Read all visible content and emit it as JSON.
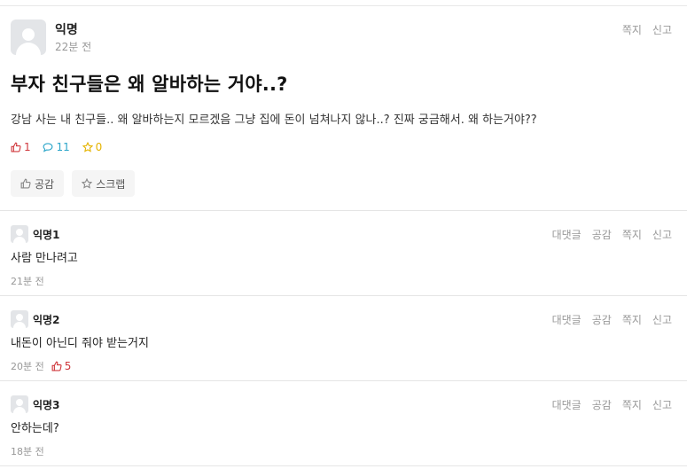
{
  "post": {
    "author": "익명",
    "time": "22분 전",
    "actions": {
      "message": "쪽지",
      "report": "신고"
    },
    "title": "부자 친구들은 왜 알바하는 거야..?",
    "content": "강남 사는 내 친구들.. 왜 알바하는지 모르겠음 그냥 집에 돈이 넘쳐나지 않나..? 진짜 궁금해서. 왜 하는거야??",
    "stats": {
      "likes": "1",
      "comments": "11",
      "scraps": "0"
    },
    "buttons": {
      "like": "공감",
      "scrap": "스크랩"
    }
  },
  "comment_actions": {
    "reply": "대댓글",
    "like": "공감",
    "message": "쪽지",
    "report": "신고"
  },
  "comments": [
    {
      "author": "익명1",
      "text": "사람 만나려고",
      "time": "21분 전",
      "likes": ""
    },
    {
      "author": "익명2",
      "text": "내돈이 아닌디 줘야 받는거지",
      "time": "20분 전",
      "likes": "5"
    },
    {
      "author": "익명3",
      "text": "안하는데?",
      "time": "18분 전",
      "likes": ""
    }
  ],
  "colors": {
    "like": "#d0393e",
    "comment": "#2ba5c9",
    "scrap": "#e5b300"
  },
  "icons": {
    "avatar": "person-icon",
    "like": "thumbs-up-icon",
    "comment": "speech-bubble-icon",
    "scrap": "star-icon"
  }
}
